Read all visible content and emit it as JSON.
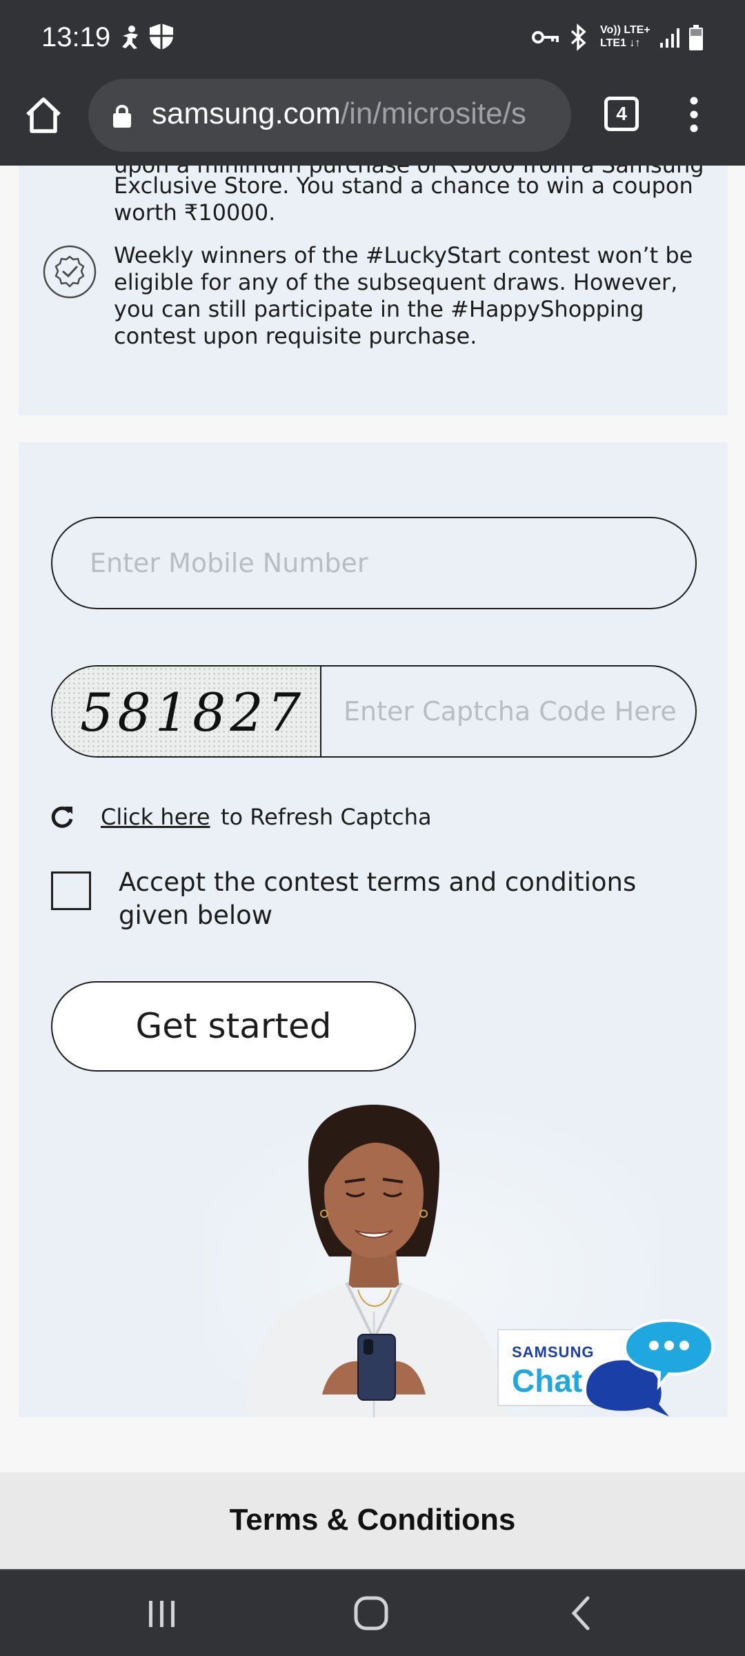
{
  "status_bar": {
    "time": "13:19",
    "network_line1": "Vo)) LTE+",
    "network_line2": "LTE1 ↓↑",
    "icons": [
      "accessibility-icon",
      "shield-icon",
      "vpn-key-icon",
      "bluetooth-icon",
      "signal-icon",
      "battery-icon"
    ]
  },
  "browser": {
    "url_domain": "samsung.com",
    "url_path": "/in/microsite/s",
    "tab_count": "4"
  },
  "info": {
    "partial_line": "upon a minimum purchase of ₹5000 from a Samsung",
    "line_store": "Exclusive Store. You stand a chance to win a coupon",
    "line_worth": "worth ₹10000.",
    "weekly_note": "Weekly winners of the #LuckyStart contest won’t be eligible for any of the subsequent draws. However, you can still participate in the #HappyShopping contest upon requisite purchase."
  },
  "form": {
    "mobile_placeholder": "Enter Mobile Number",
    "captcha_code": "581827",
    "captcha_placeholder": "Enter Captcha Code Here",
    "refresh_link": "Click here",
    "refresh_rest": "to Refresh Captcha",
    "accept_label": "Accept the contest terms and conditions given below",
    "accept_checked": false,
    "submit_label": "Get started"
  },
  "chat": {
    "brand": "SAMSUNG",
    "label": "Chat"
  },
  "footer": {
    "terms_title": "Terms & Conditions"
  },
  "colors": {
    "chrome_dark": "#323337",
    "panel_bg": "#eaf0f6",
    "chat_blue": "#1a48b8",
    "chat_cyan": "#1fa8e0"
  }
}
